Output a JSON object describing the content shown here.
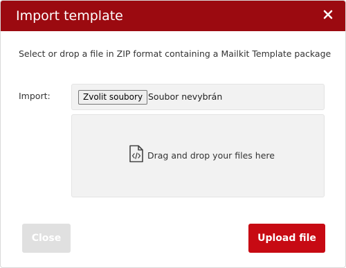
{
  "dialog": {
    "title": "Import template",
    "close_icon": "close-icon",
    "intro": "Select or drop a file in ZIP format containing a Mailkit Template package"
  },
  "import": {
    "label": "Import:",
    "choose_button": "Zvolit soubory",
    "status": "Soubor nevybrán"
  },
  "dropzone": {
    "icon": "code-file-icon",
    "text": "Drag and drop your files here"
  },
  "footer": {
    "close_label": "Close",
    "upload_label": "Upload file"
  },
  "colors": {
    "header": "#9b0a10",
    "primary_button": "#c70a13",
    "disabled_button": "#e0e0e0"
  }
}
